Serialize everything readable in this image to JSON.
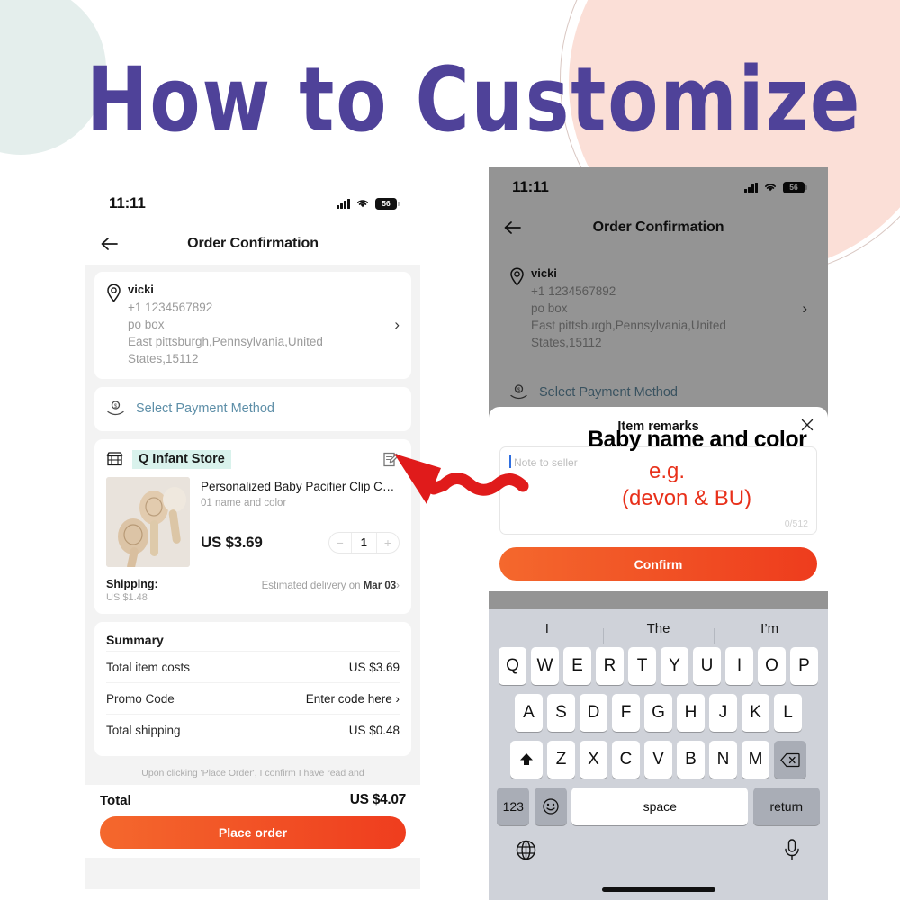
{
  "title": "How to Customize",
  "colors": {
    "title_purple": "#4f4299",
    "accent_orange": "#f4682d",
    "accent_red": "#ef3d1e",
    "annotation_red": "#e8301a",
    "highlight_mint": "#d9f2ec",
    "deco_pink": "#fbdfd7",
    "deco_mint": "#e4eeec"
  },
  "status_bar": {
    "time": "11:11",
    "battery": "56",
    "signal_icon": "cellular-bars-icon",
    "wifi_icon": "wifi-icon",
    "battery_icon": "battery-icon"
  },
  "nav": {
    "back_icon": "back-arrow-icon",
    "title": "Order Confirmation"
  },
  "address": {
    "icon": "location-pin-icon",
    "name": "vicki",
    "phone": "+1 1234567892",
    "line1": "po box",
    "line2": "East pittsburgh,Pennsylvania,United",
    "line3": "States,15112",
    "chevron": "›"
  },
  "payment": {
    "icon": "payment-hand-icon",
    "label": "Select Payment Method"
  },
  "store": {
    "icon": "storefront-icon",
    "name": "Q Infant Store",
    "edit_icon": "note-edit-icon"
  },
  "product": {
    "thumb_alt": "wooden-baby-brushes-photo",
    "title": "Personalized Baby Pacifier Clip Custo…",
    "variant": "01 name and color",
    "price": "US $3.69",
    "qty": "1",
    "minus": "−",
    "plus": "+"
  },
  "shipping": {
    "label": "Shipping:",
    "cost": "US $1.48",
    "estimate_prefix": "Estimated delivery on ",
    "estimate_date": "Mar 03",
    "chevron": "›"
  },
  "summary": {
    "title": "Summary",
    "rows": [
      {
        "label": "Total item costs",
        "value": "US $3.69"
      },
      {
        "label": "Promo Code",
        "value": "Enter code here ›"
      },
      {
        "label": "Total shipping",
        "value": "US $0.48"
      }
    ]
  },
  "disclaimer": "Upon clicking 'Place Order', I confirm I have read and",
  "footer": {
    "total_label": "Total",
    "total_value": "US $4.07",
    "cta_label": "Place order"
  },
  "modal": {
    "title": "Item remarks",
    "close_icon": "close-x-icon",
    "note_placeholder": "Note to seller",
    "char_counter": "0/512",
    "confirm_label": "Confirm"
  },
  "annotations": {
    "heading": "Baby name and color",
    "example_label": "e.g.",
    "example_value": "(devon & BU)",
    "arrow_icon": "red-wavy-arrow-icon"
  },
  "keyboard": {
    "predictions": [
      "I",
      "The",
      "I’m"
    ],
    "row1": [
      "Q",
      "W",
      "E",
      "R",
      "T",
      "Y",
      "U",
      "I",
      "O",
      "P"
    ],
    "row2": [
      "A",
      "S",
      "D",
      "F",
      "G",
      "H",
      "J",
      "K",
      "L"
    ],
    "row3": [
      "Z",
      "X",
      "C",
      "V",
      "B",
      "N",
      "M"
    ],
    "shift_icon": "shift-arrow-icon",
    "backspace_icon": "backspace-icon",
    "numbers_key": "123",
    "emoji_icon": "emoji-smiley-icon",
    "space_key": "space",
    "return_key": "return",
    "globe_icon": "globe-icon",
    "mic_icon": "microphone-icon"
  }
}
